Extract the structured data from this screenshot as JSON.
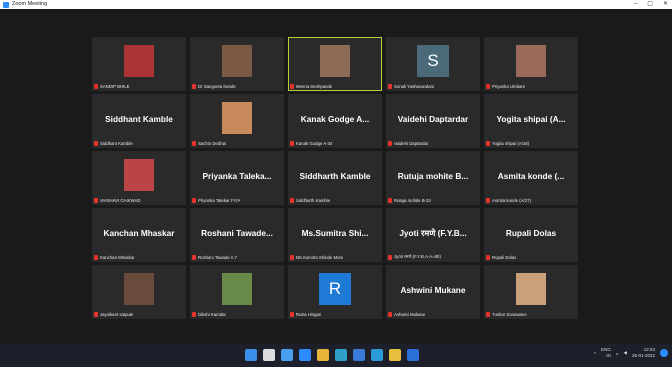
{
  "window": {
    "title": "Zoom Meeting",
    "controls": [
      "–",
      "▢",
      "✕"
    ]
  },
  "participants": [
    {
      "big": "",
      "label": "SANDIP BHILE",
      "avatar": "photo",
      "color": "#a33"
    },
    {
      "big": "",
      "label": "Dr Sangeeta Kande",
      "avatar": "photo",
      "color": "#7a5a44"
    },
    {
      "big": "",
      "label": "Meena Deshpande",
      "avatar": "photo",
      "color": "#8b6b55",
      "active": true
    },
    {
      "big": "",
      "label": "Sonali Yashavandani",
      "avatar": "letter",
      "letter": "S",
      "color": "#4a6a7a"
    },
    {
      "big": "",
      "label": "Priyanka Umbare",
      "avatar": "photo",
      "color": "#9a6a5a"
    },
    {
      "big": "Siddhant Kamble",
      "label": "Siddhant Kamble"
    },
    {
      "big": "",
      "label": "Sachin Dedhia",
      "avatar": "photo",
      "color": "#c88a5a"
    },
    {
      "big": "Kanak Godge A...",
      "label": "Kanak Godge A-34"
    },
    {
      "big": "Vaidehi Daptardar",
      "label": "Vaidehi Daptardar"
    },
    {
      "big": "Yogita shipai (A...",
      "label": "Yogita shipai (A/18)"
    },
    {
      "big": "",
      "label": "VAISHAVI GAIKWAD",
      "avatar": "photo",
      "color": "#b44"
    },
    {
      "big": "Priyanka Taleka...",
      "label": "Priyanka Talekar FY/A"
    },
    {
      "big": "Siddharth Kamble",
      "label": "Siddharth Kamble"
    },
    {
      "big": "Rutuja mohite B...",
      "label": "Rutuja mohite B-33"
    },
    {
      "big": "Asmita konde (...",
      "label": "Asmita konde (A/27)"
    },
    {
      "big": "Kanchan Mhaskar",
      "label": "Kanchan Mhaskar"
    },
    {
      "big": "Roshani Tawade...",
      "label": "Roshani Tawade A 7"
    },
    {
      "big": "Ms.Sumitra Shi...",
      "label": "Ms.Sumitra Shinde More"
    },
    {
      "big": "Jyoti रमणे (F.Y.B...",
      "label": "Jyoti रमणे (F.Y.B.A-A=80)"
    },
    {
      "big": "Rupali Dolas",
      "label": "Rupali Dolas"
    },
    {
      "big": "",
      "label": "Jaynikant satpute",
      "avatar": "photo",
      "color": "#6a4a3a"
    },
    {
      "big": "",
      "label": "Dikshi Kamdar",
      "avatar": "photo",
      "color": "#6a8a4a"
    },
    {
      "big": "",
      "label": "Rutra Hingari",
      "avatar": "letter",
      "letter": "R",
      "color": "#1f7ad6"
    },
    {
      "big": "Ashwini Mukane",
      "label": "Ashwini Mukane"
    },
    {
      "big": "",
      "label": "Tushar Sonawane",
      "avatar": "photo",
      "color": "#c9a07a"
    }
  ],
  "taskbar": {
    "icons": [
      {
        "name": "start-icon",
        "color": "#3a8fe8"
      },
      {
        "name": "search-icon",
        "color": "#dddddd"
      },
      {
        "name": "taskview-icon",
        "color": "#4aa0f0"
      },
      {
        "name": "zoom-icon",
        "color": "#2d8cff"
      },
      {
        "name": "chrome-icon",
        "color": "#e8b43a"
      },
      {
        "name": "edge-icon",
        "color": "#2fa0c8"
      },
      {
        "name": "store-icon",
        "color": "#3a7ad8"
      },
      {
        "name": "browser-icon",
        "color": "#2a9ad8"
      },
      {
        "name": "folder-icon",
        "color": "#e8c040"
      },
      {
        "name": "zoom-app-icon",
        "color": "#2d6fd8"
      }
    ],
    "tray": {
      "lang_top": "ENG",
      "lang_bottom": "IN",
      "time": "12:53",
      "date": "25-01-2022"
    }
  }
}
